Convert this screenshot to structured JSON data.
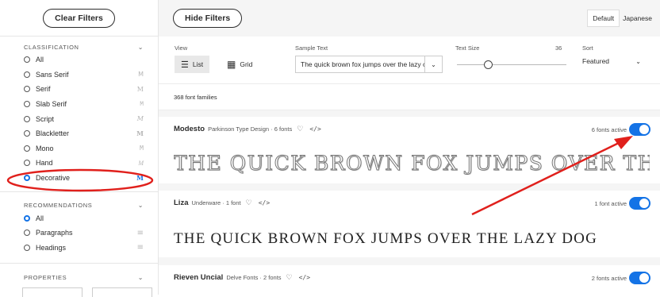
{
  "sidebar": {
    "clear_label": "Clear Filters",
    "classification": {
      "heading": "CLASSIFICATION",
      "items": [
        {
          "label": "All",
          "glyph": ""
        },
        {
          "label": "Sans Serif",
          "glyph": "M"
        },
        {
          "label": "Serif",
          "glyph": "M"
        },
        {
          "label": "Slab Serif",
          "glyph": "M"
        },
        {
          "label": "Script",
          "glyph": "M"
        },
        {
          "label": "Blackletter",
          "glyph": "M"
        },
        {
          "label": "Mono",
          "glyph": "M"
        },
        {
          "label": "Hand",
          "glyph": "M"
        },
        {
          "label": "Decorative",
          "glyph": "M"
        }
      ],
      "selected": "Decorative"
    },
    "recommendations": {
      "heading": "RECOMMENDATIONS",
      "items": [
        {
          "label": "All"
        },
        {
          "label": "Paragraphs"
        },
        {
          "label": "Headings"
        }
      ],
      "selected": "All"
    },
    "properties_heading": "PROPERTIES"
  },
  "topbar": {
    "hide_label": "Hide Filters",
    "lang_default": "Default",
    "lang_japanese": "Japanese"
  },
  "toolbar": {
    "view_label": "View",
    "list_label": "List",
    "grid_label": "Grid",
    "sample_label": "Sample Text",
    "sample_value": "The quick brown fox jumps over the lazy c",
    "size_label": "Text Size",
    "size_value": "36",
    "size_fraction": 0.28,
    "sort_label": "Sort",
    "sort_value": "Featured"
  },
  "family_count": "368 font families",
  "cards": [
    {
      "name": "Modesto",
      "foundry": "Parkinson Type Design",
      "count": "6 fonts",
      "active": "6 fonts active",
      "sample": "THE QUICK BROWN FOX JUMPS OVER THE L"
    },
    {
      "name": "Liza",
      "foundry": "Underware",
      "count": "1 font",
      "active": "1 font active",
      "sample": "THE QUICK BROWN FOX JUMPS OVER THE LAZY DOG"
    },
    {
      "name": "Rieven Uncial",
      "foundry": "Delve Fonts",
      "count": "2 fonts",
      "active": "2 fonts active",
      "sample": ""
    }
  ],
  "colors": {
    "accent": "#1473e6",
    "annotation": "#e0201c"
  },
  "icons": {
    "heart": "heart-icon",
    "code": "code-icon"
  }
}
